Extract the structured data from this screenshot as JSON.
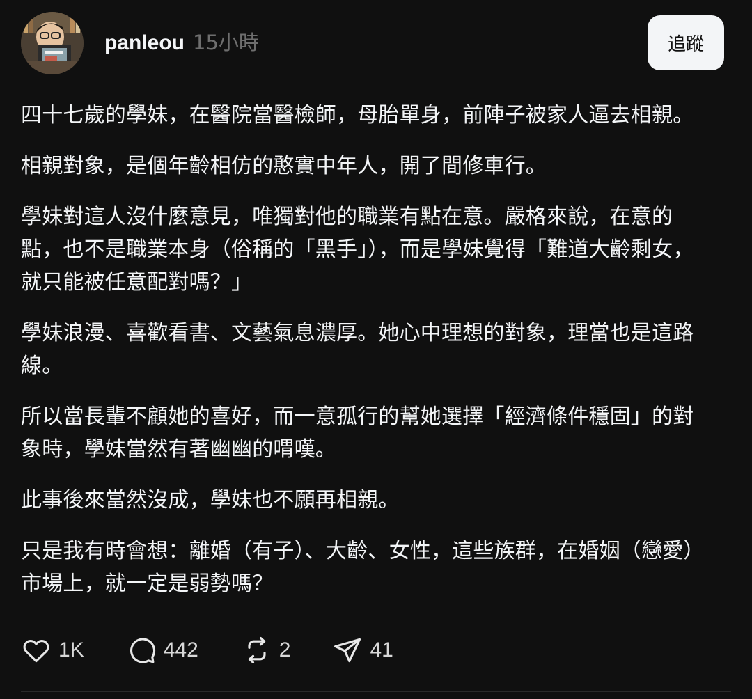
{
  "post": {
    "author": {
      "username": "panleou",
      "time": "15小時"
    },
    "follow_label": "追蹤",
    "paragraphs": [
      "四十七歲的學妹，在醫院當醫檢師，母胎單身，前陣子被家人逼去相親。",
      "相親對象，是個年齡相仿的憨實中年人，開了間修車行。",
      "學妹對這人沒什麼意見，唯獨對他的職業有點在意。嚴格來說，在意的點，也不是職業本身（俗稱的「黑手」），而是學妹覺得「難道大齡剩女，就只能被任意配對嗎？」",
      "學妹浪漫、喜歡看書、文藝氣息濃厚。她心中理想的對象，理當也是這路線。",
      "所以當長輩不顧她的喜好，而一意孤行的幫她選擇「經濟條件穩固」的對象時，學妹當然有著幽幽的喟嘆。",
      "此事後來當然沒成，學妹也不願再相親。",
      "只是我有時會想：離婚（有子）、大齡、女性，這些族群，在婚姻（戀愛）市場上，就一定是弱勢嗎？"
    ],
    "actions": {
      "likes": "1K",
      "replies": "442",
      "reposts": "2",
      "shares": "41"
    }
  },
  "icons": {
    "like": "heart-icon",
    "reply": "speech-bubble-icon",
    "repost": "repost-icon",
    "share": "paper-plane-icon"
  },
  "colors": {
    "background": "#101010",
    "text": "#f3f5f7",
    "muted": "#6e6e6e",
    "button_bg": "#f3f5f7"
  }
}
